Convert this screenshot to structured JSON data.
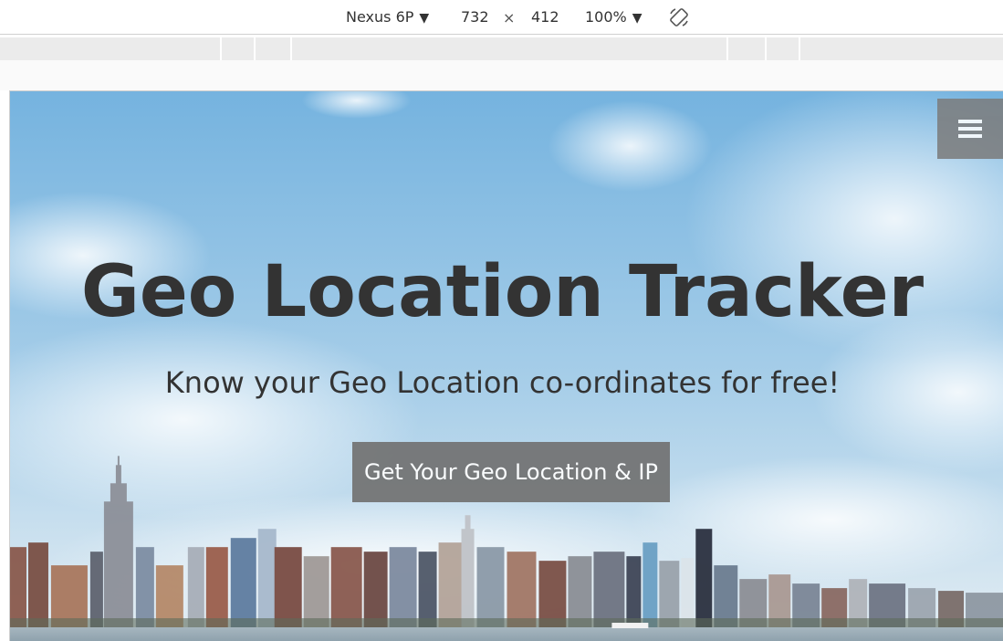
{
  "devtools": {
    "device_name": "Nexus 6P",
    "width": "732",
    "times": "×",
    "height": "412",
    "zoom": "100%",
    "caret": "▼",
    "rotate_icon": "rotate-icon"
  },
  "hero": {
    "title": "Geo Location Tracker",
    "subtitle": "Know your Geo Location co-ordinates for free!",
    "cta_label": "Get Your Geo Location & IP",
    "menu_icon": "hamburger-menu-icon"
  },
  "colors": {
    "sky_top": "#79b6e0",
    "sky_bottom": "#d9e8f2",
    "title_text": "#333333",
    "button_bg": "#727272",
    "button_text": "#ffffff",
    "toolbar_bg": "#ffffff",
    "mq_bar": "#ebebeb"
  }
}
